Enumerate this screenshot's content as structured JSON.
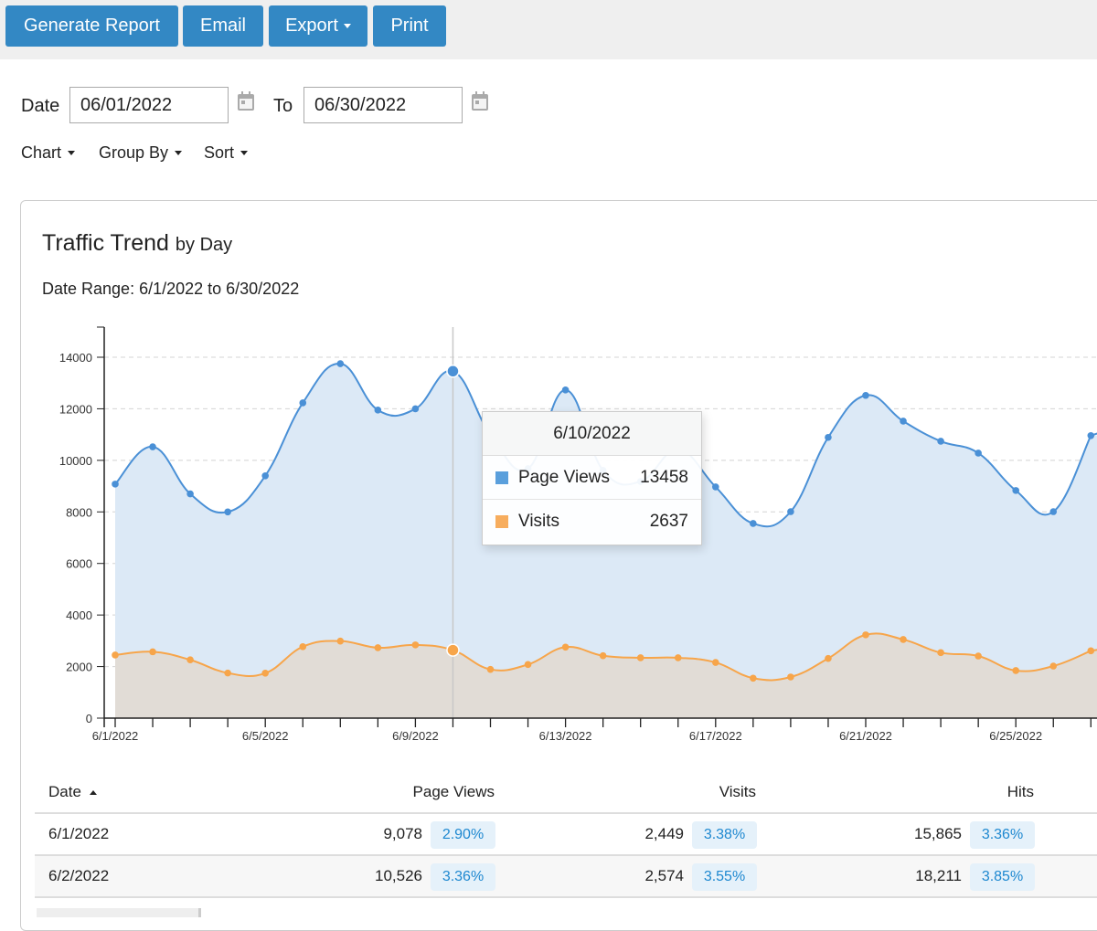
{
  "toolbar": {
    "generate": "Generate Report",
    "email": "Email",
    "export": "Export",
    "print": "Print"
  },
  "filters": {
    "date_label": "Date",
    "from": "06/01/2022",
    "to_label": "To",
    "to": "06/30/2022",
    "chart": "Chart",
    "group_by": "Group By",
    "sort": "Sort"
  },
  "card": {
    "title": "Traffic Trend",
    "title_suffix": "by Day",
    "date_range": "Date Range: 6/1/2022 to 6/30/2022"
  },
  "tooltip": {
    "date": "6/10/2022",
    "rows": [
      {
        "label": "Page Views",
        "value": "13458"
      },
      {
        "label": "Visits",
        "value": "2637"
      }
    ]
  },
  "colors": {
    "page_views": "#4a90d6",
    "visits": "#f7a54a",
    "page_views_fill": "#dce9f6",
    "visits_fill": "#e1dcd6",
    "button": "#3388c4"
  },
  "chart_data": {
    "type": "area",
    "x": [
      "6/1/2022",
      "6/2/2022",
      "6/3/2022",
      "6/4/2022",
      "6/5/2022",
      "6/6/2022",
      "6/7/2022",
      "6/8/2022",
      "6/9/2022",
      "6/10/2022",
      "6/11/2022",
      "6/12/2022",
      "6/13/2022",
      "6/14/2022",
      "6/15/2022",
      "6/16/2022",
      "6/17/2022",
      "6/18/2022",
      "6/19/2022",
      "6/20/2022",
      "6/21/2022",
      "6/22/2022",
      "6/23/2022",
      "6/24/2022",
      "6/25/2022",
      "6/26/2022",
      "6/27/2022"
    ],
    "x_tick_labels": [
      "6/1/2022",
      "6/5/2022",
      "6/9/2022",
      "6/13/2022",
      "6/17/2022",
      "6/21/2022",
      "6/25/2022"
    ],
    "series": [
      {
        "name": "Page Views",
        "values": [
          9078,
          10526,
          8700,
          8000,
          9400,
          12230,
          13750,
          11950,
          12000,
          13458,
          11000,
          9680,
          12730,
          9610,
          9180,
          10420,
          8970,
          7550,
          8010,
          10890,
          12520,
          11520,
          10740,
          10280,
          8830,
          8010,
          10960
        ]
      },
      {
        "name": "Visits",
        "values": [
          2449,
          2574,
          2260,
          1750,
          1745,
          2770,
          2990,
          2730,
          2840,
          2637,
          1890,
          2080,
          2755,
          2420,
          2340,
          2340,
          2160,
          1550,
          1595,
          2315,
          3230,
          3050,
          2540,
          2410,
          1845,
          2020,
          2610
        ]
      }
    ],
    "ylim": [
      0,
      15000
    ],
    "y_ticks": [
      0,
      2000,
      4000,
      6000,
      8000,
      10000,
      12000,
      14000
    ],
    "grid": true,
    "highlight": "6/10/2022"
  },
  "table": {
    "headers": {
      "date": "Date",
      "page_views": "Page Views",
      "visits": "Visits",
      "hits": "Hits"
    },
    "rows": [
      {
        "date": "6/1/2022",
        "page_views": "9,078",
        "pv_pct": "2.90%",
        "visits": "2,449",
        "v_pct": "3.38%",
        "hits": "15,865",
        "h_pct": "3.36%"
      },
      {
        "date": "6/2/2022",
        "page_views": "10,526",
        "pv_pct": "3.36%",
        "visits": "2,574",
        "v_pct": "3.55%",
        "hits": "18,211",
        "h_pct": "3.85%"
      }
    ]
  }
}
